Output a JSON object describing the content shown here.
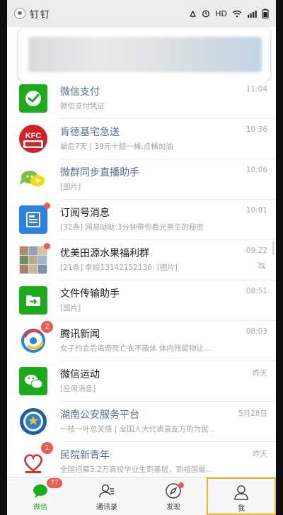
{
  "status_bar": {
    "app_name": "钉钉",
    "network": "HD",
    "icons": [
      "dingtalk-icon",
      "vibrate-icon",
      "alarm-icon",
      "wifi-icon",
      "signal-icon",
      "battery-icon"
    ]
  },
  "notification_banner": {
    "icon": "blurred-notification"
  },
  "chats": [
    {
      "name": "微信支付",
      "preview": "微信支付凭证",
      "time": "11:04",
      "avatar": "wechat-pay-icon",
      "service": true
    },
    {
      "name": "肯德基宅急送",
      "preview": "最后7天 | 39元十翅一桶,点桶加油",
      "time": "10:36",
      "avatar": "kfc-logo",
      "service": true
    },
    {
      "name": "微群同步直播助手",
      "preview": "[图片]",
      "time": "10:06",
      "avatar": "live-assistant-icon",
      "service": true
    },
    {
      "name": "订阅号消息",
      "preview": "[32条] 网易哒哒:3分钟带你看光男生的秘密",
      "time": "10:01",
      "avatar": "subscription-icon",
      "service": false,
      "dot": true
    },
    {
      "name": "优美田源水果福利群",
      "preview": "[21条] 李姣13142152136: [图片]",
      "time": "09:22",
      "avatar": "group-avatar",
      "service": false,
      "dot": true,
      "muted": true
    },
    {
      "name": "文件传输助手",
      "preview": "[图片]",
      "time": "08:51",
      "avatar": "file-transfer-icon",
      "service": false
    },
    {
      "name": "腾讯新闻",
      "preview": "女子约会后离奇死亡衣不蔽体 体内残留物让...",
      "time": "08:03",
      "avatar": "tencent-news-icon",
      "service": false,
      "badge": "2"
    },
    {
      "name": "微信运动",
      "preview": "[应用消息]",
      "time": "昨天",
      "avatar": "wechat-sport-icon",
      "service": false
    },
    {
      "name": "湖南公安服务平台",
      "preview": "一枝一叶总关情 | 全国人大代表袁友方的为民...",
      "time": "5月28日",
      "avatar": "police-badge-icon",
      "service": true
    },
    {
      "name": "民院新青年",
      "preview": "全国招募3.2万高校毕业生到基层，到祖国最...",
      "time": "昨天",
      "avatar": "youth-league-icon",
      "service": true,
      "badge": "1"
    }
  ],
  "tabs": [
    {
      "label": "微信",
      "icon": "chat-bubble-icon",
      "badge": "77",
      "active": true
    },
    {
      "label": "通讯录",
      "icon": "contacts-icon"
    },
    {
      "label": "发现",
      "icon": "compass-icon",
      "dot": true
    },
    {
      "label": "我",
      "icon": "person-icon",
      "highlight": true
    }
  ],
  "colors": {
    "wechat_green": "#1aad19",
    "service_name": "#576b95",
    "badge_red": "#f05a4f",
    "highlight": "#f0b429"
  }
}
